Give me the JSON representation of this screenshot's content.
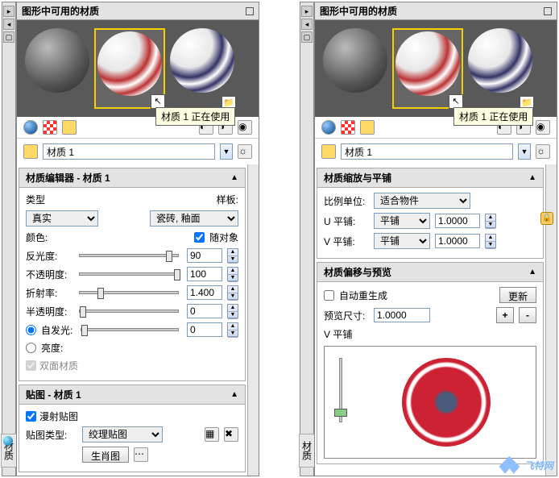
{
  "left": {
    "title": "图形中可用的材质",
    "tooltip": "材质 1\n正在使用",
    "material_name": "材质 1",
    "vertical_tab": "材质",
    "editor": {
      "header": "材质编辑器 - 材质 1",
      "type_label": "类型",
      "type_value": "真实",
      "template_label": "样板:",
      "template_value": "瓷砖, 釉面",
      "color_label": "颜色:",
      "per_object_label": "随对象",
      "reflectivity_label": "反光度:",
      "reflectivity_val": "90",
      "opacity_label": "不透明度:",
      "opacity_val": "100",
      "refraction_label": "折射率:",
      "refraction_val": "1.400",
      "translucency_label": "半透明度:",
      "translucency_val": "0",
      "selfillum_label": "自发光:",
      "selfillum_val": "0",
      "brightness_label": "亮度:",
      "twosided_label": "双面材质"
    },
    "textures": {
      "header": "贴图 - 材质 1",
      "diffuse_label": "漫射贴图",
      "type_label": "贴图类型:",
      "type_value": "绞理贴图",
      "button": "生肖图"
    }
  },
  "right": {
    "title": "图形中可用的材质",
    "tooltip": "材质 1\n正在使用",
    "material_name": "材质 1",
    "vertical_tab": "材质",
    "scaling": {
      "header": "材质缩放与平铺",
      "scale_label": "比例单位:",
      "scale_value": "适合物件",
      "utile_label": "U 平铺:",
      "utile_mode": "平铺",
      "utile_val": "1.0000",
      "vtile_label": "V 平铺:",
      "vtile_mode": "平铺",
      "vtile_val": "1.0000"
    },
    "preview": {
      "header": "材质偏移与预览",
      "autoregen_label": "自动重生成",
      "update_btn": "更新",
      "size_label": "预览尺寸:",
      "size_val": "1.0000",
      "vslider_label": "V 平铺"
    },
    "watermark": "飞特网"
  }
}
